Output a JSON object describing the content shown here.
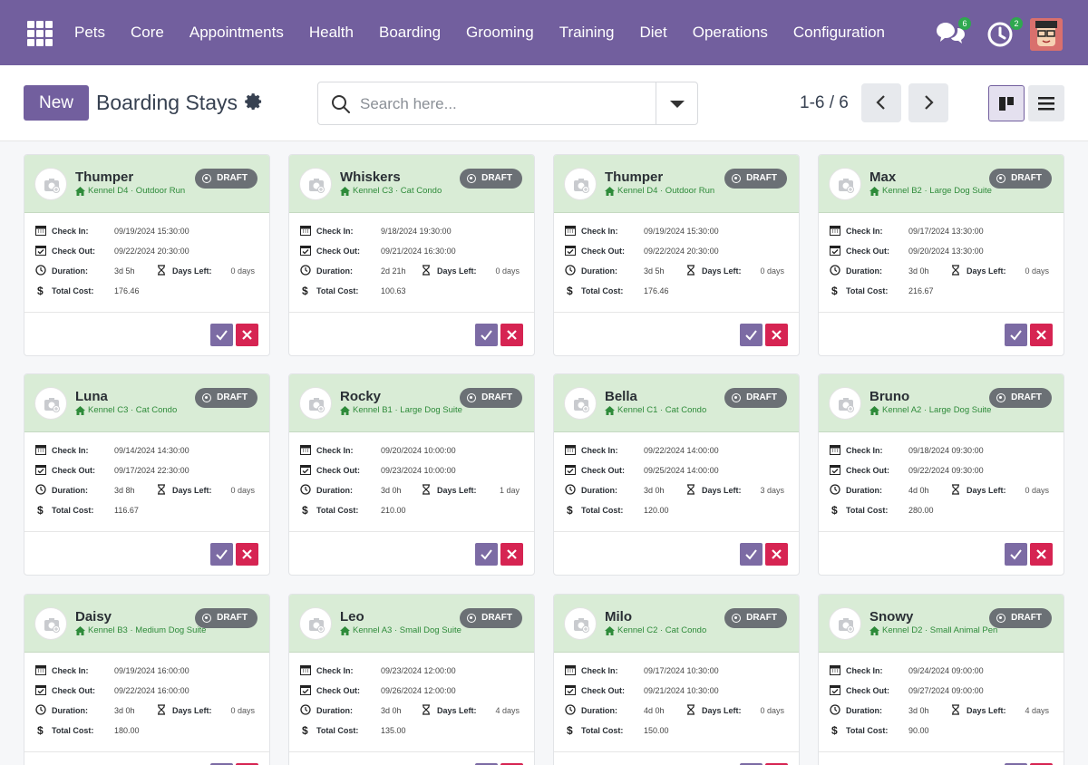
{
  "navbar": {
    "menu": [
      "Pets",
      "Core",
      "Appointments",
      "Health",
      "Boarding",
      "Grooming",
      "Training",
      "Diet",
      "Operations",
      "Configuration"
    ],
    "messages_badge": "6",
    "activities_badge": "2"
  },
  "control": {
    "new_label": "New",
    "title": "Boarding Stays",
    "search_placeholder": "Search here...",
    "pager": "1-6 / 6"
  },
  "labels": {
    "check_in": "Check In:",
    "check_out": "Check Out:",
    "duration": "Duration:",
    "days_left": "Days Left:",
    "total_cost": "Total Cost:"
  },
  "cards": [
    {
      "name": "Thumper",
      "kennel": "Kennel D4 · Outdoor Run",
      "status": "DRAFT",
      "check_in": "09/19/2024 15:30:00",
      "check_out": "09/22/2024 20:30:00",
      "duration": "3d 5h",
      "days_left": "0 days",
      "total_cost": "176.46"
    },
    {
      "name": "Whiskers",
      "kennel": "Kennel C3 · Cat Condo",
      "status": "DRAFT",
      "check_in": "9/18/2024 19:30:00",
      "check_out": "09/21/2024 16:30:00",
      "duration": "2d 21h",
      "days_left": "0 days",
      "total_cost": "100.63"
    },
    {
      "name": "Thumper",
      "kennel": "Kennel D4 · Outdoor Run",
      "status": "DRAFT",
      "check_in": "09/19/2024 15:30:00",
      "check_out": "09/22/2024 20:30:00",
      "duration": "3d 5h",
      "days_left": "0 days",
      "total_cost": "176.46"
    },
    {
      "name": "Max",
      "kennel": "Kennel B2 · Large Dog Suite",
      "status": "DRAFT",
      "check_in": "09/17/2024 13:30:00",
      "check_out": "09/20/2024 13:30:00",
      "duration": "3d 0h",
      "days_left": "0 days",
      "total_cost": "216.67"
    },
    {
      "name": "Luna",
      "kennel": "Kennel C3 · Cat Condo",
      "status": "DRAFT",
      "check_in": "09/14/2024 14:30:00",
      "check_out": "09/17/2024 22:30:00",
      "duration": "3d 8h",
      "days_left": "0 days",
      "total_cost": "116.67"
    },
    {
      "name": "Rocky",
      "kennel": "Kennel B1 · Large Dog Suite",
      "status": "DRAFT",
      "check_in": "09/20/2024 10:00:00",
      "check_out": "09/23/2024 10:00:00",
      "duration": "3d 0h",
      "days_left": "1 day",
      "total_cost": "210.00"
    },
    {
      "name": "Bella",
      "kennel": "Kennel C1 · Cat Condo",
      "status": "DRAFT",
      "check_in": "09/22/2024 14:00:00",
      "check_out": "09/25/2024 14:00:00",
      "duration": "3d 0h",
      "days_left": "3 days",
      "total_cost": "120.00"
    },
    {
      "name": "Bruno",
      "kennel": "Kennel A2 · Large Dog Suite",
      "status": "DRAFT",
      "check_in": "09/18/2024 09:30:00",
      "check_out": "09/22/2024 09:30:00",
      "duration": "4d 0h",
      "days_left": "0 days",
      "total_cost": "280.00"
    },
    {
      "name": "Daisy",
      "kennel": "Kennel B3 · Medium Dog Suite",
      "status": "DRAFT",
      "check_in": "09/19/2024 16:00:00",
      "check_out": "09/22/2024 16:00:00",
      "duration": "3d 0h",
      "days_left": "0 days",
      "total_cost": "180.00"
    },
    {
      "name": "Leo",
      "kennel": "Kennel A3 · Small Dog Suite",
      "status": "DRAFT",
      "check_in": "09/23/2024 12:00:00",
      "check_out": "09/26/2024 12:00:00",
      "duration": "3d 0h",
      "days_left": "4 days",
      "total_cost": "135.00"
    },
    {
      "name": "Milo",
      "kennel": "Kennel C2 · Cat Condo",
      "status": "DRAFT",
      "check_in": "09/17/2024 10:30:00",
      "check_out": "09/21/2024 10:30:00",
      "duration": "4d 0h",
      "days_left": "0 days",
      "total_cost": "150.00"
    },
    {
      "name": "Snowy",
      "kennel": "Kennel D2 · Small Animal Pen",
      "status": "DRAFT",
      "check_in": "09/24/2024 09:00:00",
      "check_out": "09/27/2024 09:00:00",
      "duration": "3d 0h",
      "days_left": "4 days",
      "total_cost": "90.00"
    }
  ]
}
